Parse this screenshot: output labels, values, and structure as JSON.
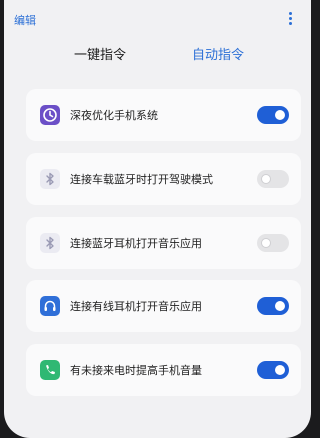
{
  "header": {
    "edit_label": "编辑",
    "more_icon": "more-vertical-icon"
  },
  "tabs": [
    {
      "label": "一键指令",
      "active": false
    },
    {
      "label": "自动指令",
      "active": true
    }
  ],
  "items": [
    {
      "label": "深夜优化手机系统",
      "icon": "clock-icon",
      "icon_color": "#6b4fc7",
      "enabled": true
    },
    {
      "label": "连接车载蓝牙时打开驾驶模式",
      "icon": "bluetooth-icon",
      "icon_color": "#9a9ab4",
      "enabled": false
    },
    {
      "label": "连接蓝牙耳机打开音乐应用",
      "icon": "bluetooth-icon",
      "icon_color": "#9a9ab4",
      "enabled": false
    },
    {
      "label": "连接有线耳机打开音乐应用",
      "icon": "headphones-icon",
      "icon_color": "#2f6fd8",
      "enabled": true
    },
    {
      "label": "有未接来电时提高手机音量",
      "icon": "phone-icon",
      "icon_color": "#2fb873",
      "enabled": true
    }
  ],
  "colors": {
    "accent": "#2b6fd6",
    "toggle_on": "#1f5fd6",
    "toggle_off": "#e4e4e6"
  }
}
